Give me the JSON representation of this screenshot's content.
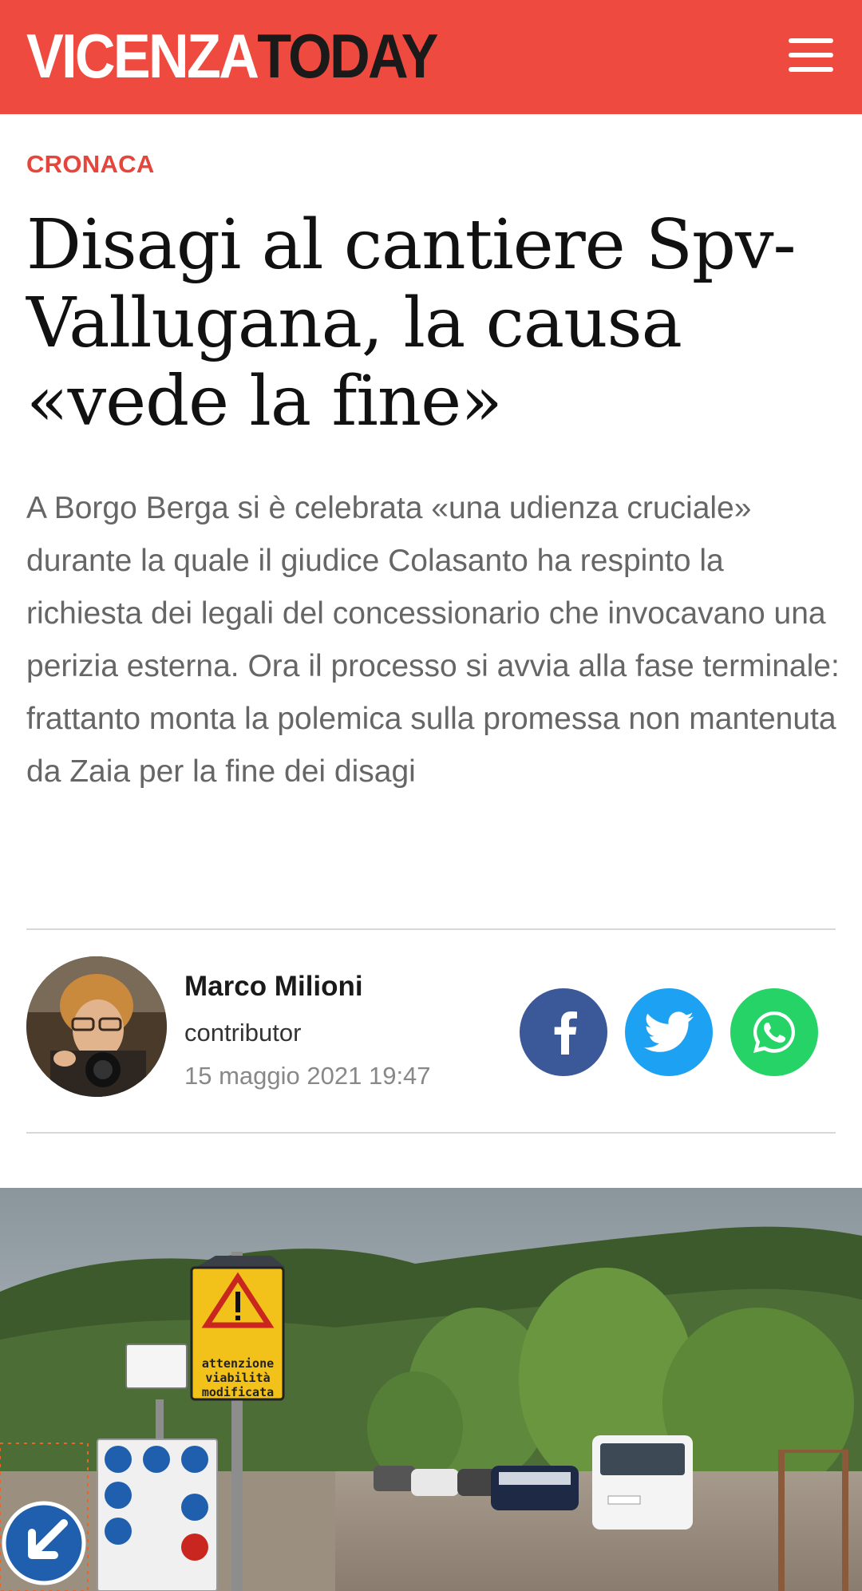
{
  "header": {
    "logo_part1": "VICENZA",
    "logo_part2": "TODAY",
    "brand_color": "#ef4a3f",
    "menu_icon": "hamburger-menu-icon"
  },
  "article": {
    "category": "CRONACA",
    "title": "Disagi al cantiere Spv-Vallugana, la causa «vede la fine»",
    "summary": "A Borgo Berga si è celebrata «una udienza cruciale» durante la quale il giudice Colasanto ha respinto la richiesta dei legali del concessionario che invocavano una perizia esterna. Ora il processo si avvia alla fase terminale: frattanto monta la polemica sulla promessa non mantenuta da Zaia per la fine dei disagi"
  },
  "author": {
    "name": "Marco Milioni",
    "role": "contributor",
    "date": "15 maggio 2021 19:47"
  },
  "share": {
    "facebook_icon": "facebook-icon",
    "twitter_icon": "twitter-icon",
    "whatsapp_icon": "whatsapp-icon",
    "facebook_color": "#3b5998",
    "twitter_color": "#1da1f2",
    "whatsapp_color": "#25d366"
  },
  "photo": {
    "sign_text_line1": "attenzione",
    "sign_text_line2": "viabilità",
    "sign_text_line3": "modificata"
  }
}
